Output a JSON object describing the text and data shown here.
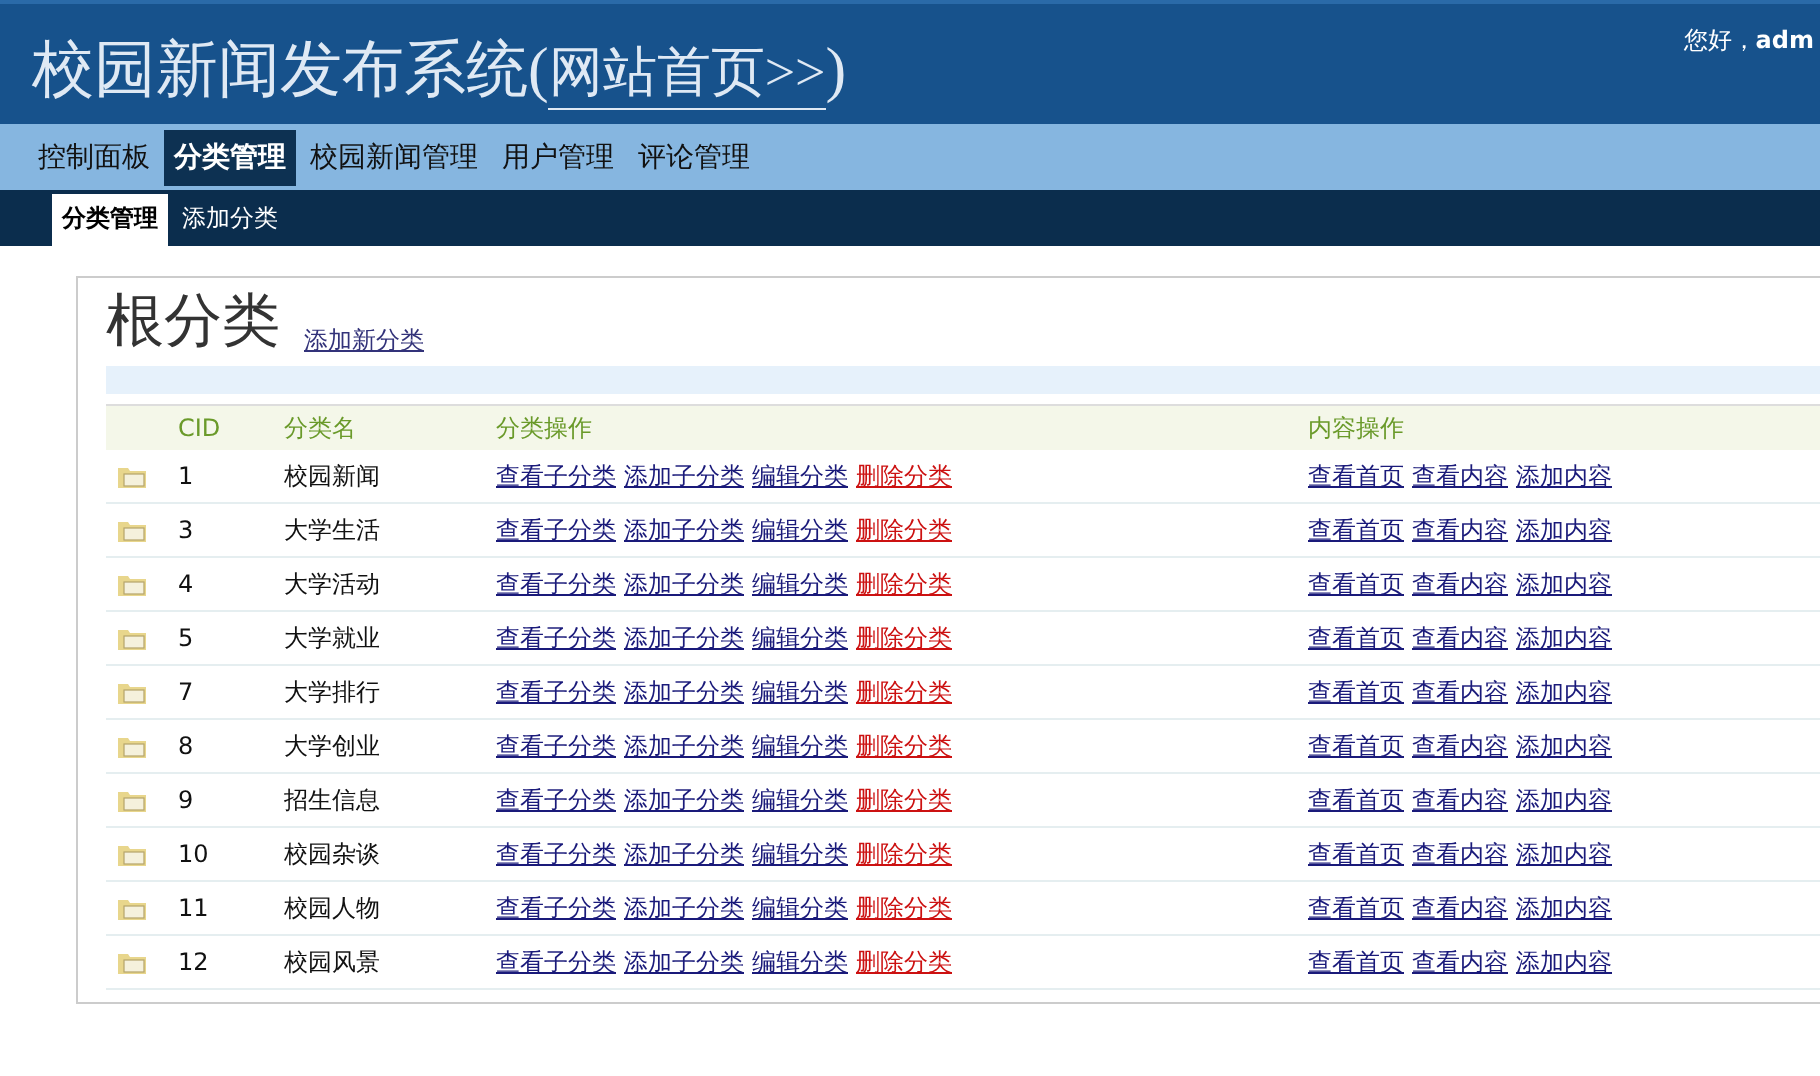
{
  "header": {
    "title": "校园新闻发布系统",
    "paren_open": "(",
    "home_link": "网站首页>>",
    "paren_close": ")",
    "greeting": "您好，**adm**"
  },
  "nav": [
    {
      "label": "控制面板",
      "selected": false
    },
    {
      "label": "分类管理",
      "selected": true
    },
    {
      "label": "校园新闻管理",
      "selected": false
    },
    {
      "label": "用户管理",
      "selected": false
    },
    {
      "label": "评论管理",
      "selected": false
    }
  ],
  "subnav": [
    {
      "label": "分类管理",
      "selected": true
    },
    {
      "label": "添加分类",
      "selected": false
    }
  ],
  "panel": {
    "title": "根分类",
    "add_link": "添加新分类"
  },
  "table": {
    "columns": [
      "CID",
      "分类名",
      "分类操作",
      "内容操作"
    ],
    "rows": [
      {
        "cid": "1",
        "name": "校园新闻",
        "category_actions": [
          {
            "label": "查看子分类",
            "kind": "link"
          },
          {
            "label": "添加子分类",
            "kind": "link"
          },
          {
            "label": "编辑分类",
            "kind": "link"
          },
          {
            "label": "删除分类",
            "kind": "delete"
          }
        ],
        "content_actions": [
          "查看首页",
          "查看内容",
          "添加内容"
        ]
      },
      {
        "cid": "3",
        "name": "大学生活",
        "category_actions": [
          {
            "label": "查看子分类",
            "kind": "link"
          },
          {
            "label": "添加子分类",
            "kind": "link"
          },
          {
            "label": "编辑分类",
            "kind": "link"
          },
          {
            "label": "删除分类",
            "kind": "delete"
          }
        ],
        "content_actions": [
          "查看首页",
          "查看内容",
          "添加内容"
        ]
      },
      {
        "cid": "4",
        "name": "大学活动",
        "category_actions": [
          {
            "label": "查看子分类",
            "kind": "link"
          },
          {
            "label": "添加子分类",
            "kind": "link"
          },
          {
            "label": "编辑分类",
            "kind": "link"
          },
          {
            "label": "删除分类",
            "kind": "delete"
          }
        ],
        "content_actions": [
          "查看首页",
          "查看内容",
          "添加内容"
        ]
      },
      {
        "cid": "5",
        "name": "大学就业",
        "category_actions": [
          {
            "label": "查看子分类",
            "kind": "link"
          },
          {
            "label": "添加子分类",
            "kind": "link"
          },
          {
            "label": "编辑分类",
            "kind": "link"
          },
          {
            "label": "删除分类",
            "kind": "delete"
          }
        ],
        "content_actions": [
          "查看首页",
          "查看内容",
          "添加内容"
        ]
      },
      {
        "cid": "7",
        "name": "大学排行",
        "category_actions": [
          {
            "label": "查看子分类",
            "kind": "link"
          },
          {
            "label": "添加子分类",
            "kind": "link"
          },
          {
            "label": "编辑分类",
            "kind": "link"
          },
          {
            "label": "删除分类",
            "kind": "delete"
          }
        ],
        "content_actions": [
          "查看首页",
          "查看内容",
          "添加内容"
        ]
      },
      {
        "cid": "8",
        "name": "大学创业",
        "category_actions": [
          {
            "label": "查看子分类",
            "kind": "link"
          },
          {
            "label": "添加子分类",
            "kind": "link"
          },
          {
            "label": "编辑分类",
            "kind": "link"
          },
          {
            "label": "删除分类",
            "kind": "delete"
          }
        ],
        "content_actions": [
          "查看首页",
          "查看内容",
          "添加内容"
        ]
      },
      {
        "cid": "9",
        "name": "招生信息",
        "category_actions": [
          {
            "label": "查看子分类",
            "kind": "link"
          },
          {
            "label": "添加子分类",
            "kind": "link"
          },
          {
            "label": "编辑分类",
            "kind": "link"
          },
          {
            "label": "删除分类",
            "kind": "delete"
          }
        ],
        "content_actions": [
          "查看首页",
          "查看内容",
          "添加内容"
        ]
      },
      {
        "cid": "10",
        "name": "校园杂谈",
        "category_actions": [
          {
            "label": "查看子分类",
            "kind": "link"
          },
          {
            "label": "添加子分类",
            "kind": "link"
          },
          {
            "label": "编辑分类",
            "kind": "link"
          },
          {
            "label": "删除分类",
            "kind": "delete"
          }
        ],
        "content_actions": [
          "查看首页",
          "查看内容",
          "添加内容"
        ]
      },
      {
        "cid": "11",
        "name": "校园人物",
        "category_actions": [
          {
            "label": "查看子分类",
            "kind": "link"
          },
          {
            "label": "添加子分类",
            "kind": "link"
          },
          {
            "label": "编辑分类",
            "kind": "link"
          },
          {
            "label": "删除分类",
            "kind": "delete"
          }
        ],
        "content_actions": [
          "查看首页",
          "查看内容",
          "添加内容"
        ]
      },
      {
        "cid": "12",
        "name": "校园风景",
        "category_actions": [
          {
            "label": "查看子分类",
            "kind": "link"
          },
          {
            "label": "添加子分类",
            "kind": "link"
          },
          {
            "label": "编辑分类",
            "kind": "link"
          },
          {
            "label": "删除分类",
            "kind": "delete"
          }
        ],
        "content_actions": [
          "查看首页",
          "查看内容",
          "添加内容"
        ]
      }
    ]
  }
}
